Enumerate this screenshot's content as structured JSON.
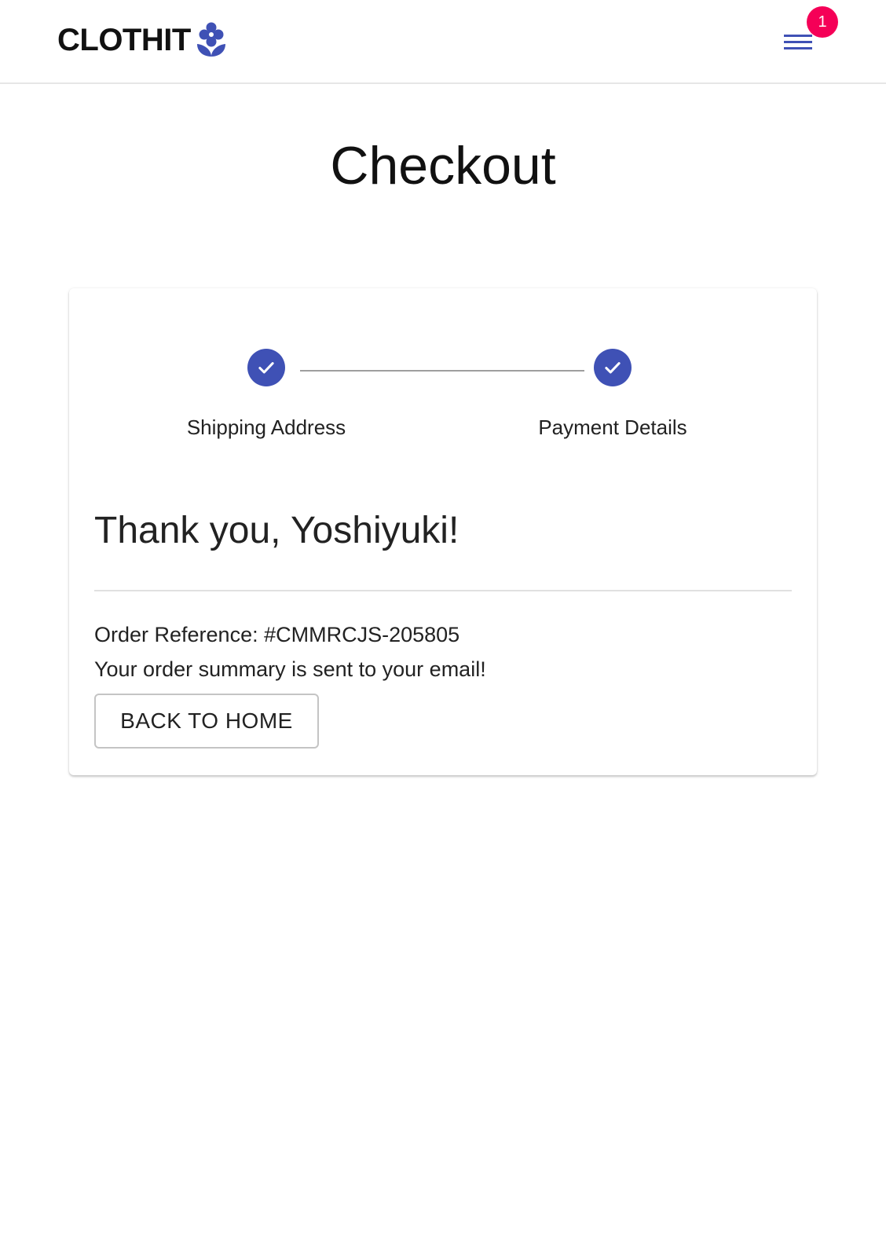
{
  "header": {
    "brand": "CLOTHIT",
    "logo_icon": "flower-icon",
    "menu_icon": "hamburger-menu-icon",
    "cart_badge_count": "1",
    "accent_color": "#3f51b5",
    "badge_color": "#f50057"
  },
  "page": {
    "title": "Checkout"
  },
  "stepper": {
    "steps": [
      {
        "label": "Shipping Address",
        "status": "completed",
        "icon": "check-icon"
      },
      {
        "label": "Payment Details",
        "status": "completed",
        "icon": "check-icon"
      }
    ]
  },
  "confirmation": {
    "heading": "Thank you, Yoshiyuki!",
    "order_reference": "Order Reference: #CMMRCJS-205805",
    "message": "Your order summary is sent to your email!",
    "back_button_label": "BACK TO HOME"
  }
}
